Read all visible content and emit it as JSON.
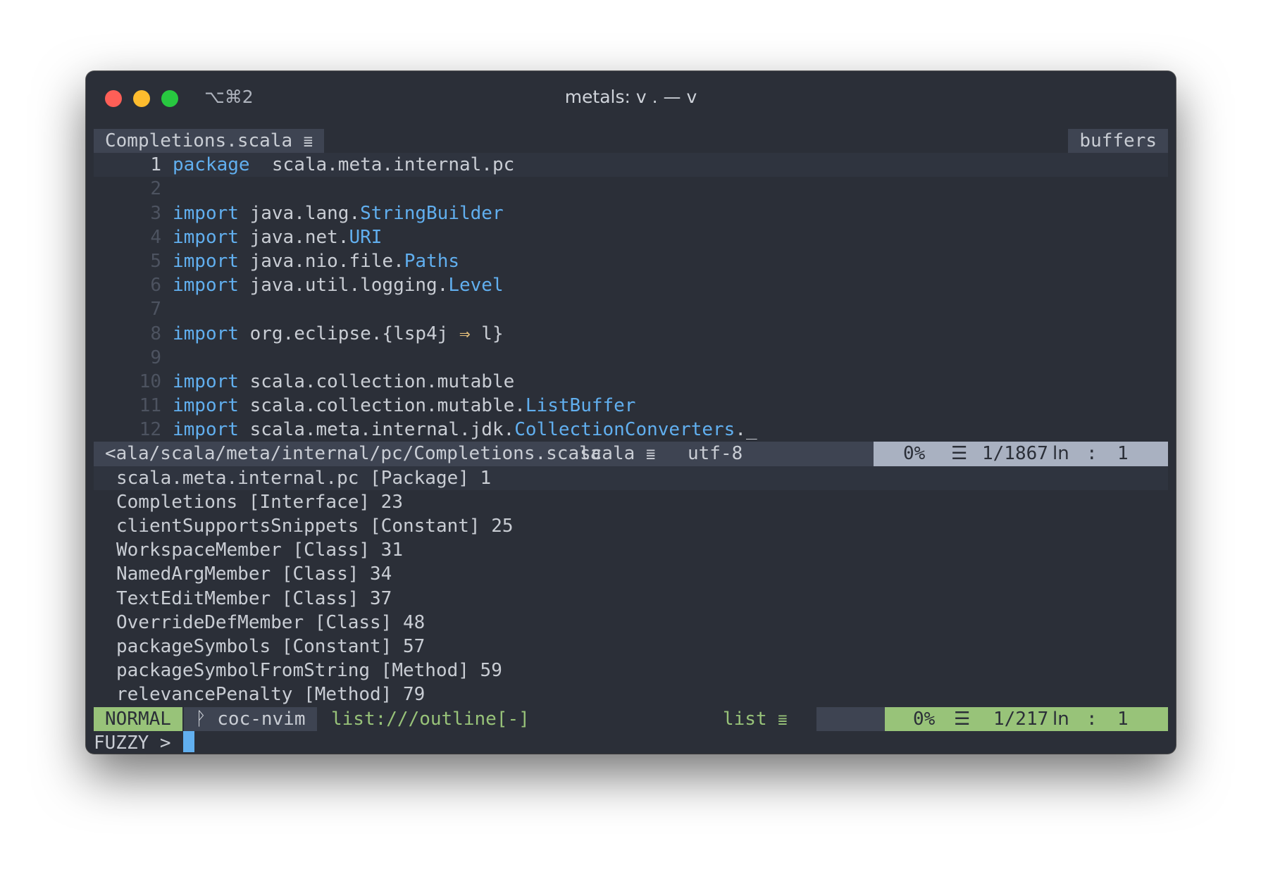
{
  "window": {
    "title": "metals: v . — v",
    "shortcut": "⌥⌘2"
  },
  "tabline": {
    "active_tab": "Completions.scala",
    "right_label": "buffers"
  },
  "editor": {
    "lines": [
      {
        "n": "1",
        "parts": [
          [
            "kw",
            "package"
          ],
          [
            "",
            "  scala.meta.internal.pc"
          ]
        ]
      },
      {
        "n": "2",
        "parts": []
      },
      {
        "n": "3",
        "parts": [
          [
            "kw",
            "import"
          ],
          [
            "",
            " java.lang."
          ],
          [
            "ty",
            "StringBuilder"
          ]
        ]
      },
      {
        "n": "4",
        "parts": [
          [
            "kw",
            "import"
          ],
          [
            "",
            " java.net."
          ],
          [
            "ty",
            "URI"
          ]
        ]
      },
      {
        "n": "5",
        "parts": [
          [
            "kw",
            "import"
          ],
          [
            "",
            " java.nio.file."
          ],
          [
            "ty",
            "Paths"
          ]
        ]
      },
      {
        "n": "6",
        "parts": [
          [
            "kw",
            "import"
          ],
          [
            "",
            " java.util.logging."
          ],
          [
            "ty",
            "Level"
          ]
        ]
      },
      {
        "n": "7",
        "parts": []
      },
      {
        "n": "8",
        "parts": [
          [
            "kw",
            "import"
          ],
          [
            "",
            " org.eclipse.{lsp4j "
          ],
          [
            "op",
            "⇒"
          ],
          [
            "",
            " l}"
          ]
        ]
      },
      {
        "n": "9",
        "parts": []
      },
      {
        "n": "10",
        "parts": [
          [
            "kw",
            "import"
          ],
          [
            "",
            " scala.collection.mutable"
          ]
        ]
      },
      {
        "n": "11",
        "parts": [
          [
            "kw",
            "import"
          ],
          [
            "",
            " scala.collection.mutable."
          ],
          [
            "ty",
            "ListBuffer"
          ]
        ]
      },
      {
        "n": "12",
        "parts": [
          [
            "kw",
            "import"
          ],
          [
            "",
            " scala.meta.internal.jdk."
          ],
          [
            "ty",
            "CollectionConverters"
          ],
          [
            "",
            "._"
          ]
        ]
      }
    ]
  },
  "statusline": {
    "path": "<ala/scala/meta/internal/pc/Completions.scala",
    "filetype": "scala",
    "encoding": "utf-8",
    "percent": "0%",
    "position": "1/1867",
    "ln_label": "ln",
    "col_sep": ":",
    "col": "1"
  },
  "outline": {
    "items": [
      "scala.meta.internal.pc [Package] 1",
      "Completions [Interface] 23",
      "clientSupportsSnippets [Constant] 25",
      "WorkspaceMember [Class] 31",
      "NamedArgMember [Class] 34",
      "TextEditMember [Class] 37",
      "OverrideDefMember [Class] 48",
      "packageSymbols [Constant] 57",
      "packageSymbolFromString [Method] 59",
      "relevancePenalty [Method] 79"
    ]
  },
  "list_status": {
    "mode": "NORMAL",
    "branch": "coc-nvim",
    "list_name": "list:///outline[-]",
    "filetype": "list",
    "percent": "0%",
    "position": "1/217",
    "ln_label": "ln",
    "col_sep": ":",
    "col": "1"
  },
  "prompt": {
    "label": "FUZZY >"
  },
  "colors": {
    "background": "#2b2f38",
    "keyword": "#61afef",
    "mode_green": "#98c379",
    "status_gray": "#a9b1c1"
  }
}
